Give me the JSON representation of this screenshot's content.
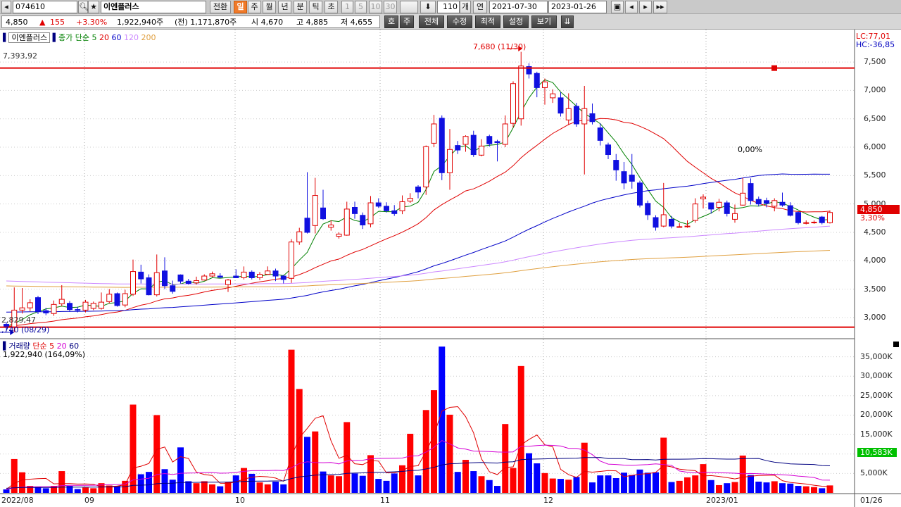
{
  "toolbar": {
    "code": "074610",
    "name": "이엔플러스",
    "convert_label": "전환",
    "periods": [
      "일",
      "주",
      "월",
      "년",
      "분",
      "틱",
      "초"
    ],
    "active_period": "일",
    "intervals": [
      "1",
      "5",
      "10",
      "30"
    ],
    "count": "110",
    "count_unit": "개",
    "year_label": "연",
    "start_date": "2021-07-30",
    "end_date": "2023-01-26"
  },
  "quote": {
    "price": "4,850",
    "change": "155",
    "change_pct": "+3.30%",
    "volume": "1,922,940주",
    "prev_volume": "(전) 1,171,870주",
    "open": "시 4,670",
    "high": "고 4,885",
    "low": "저 4,655"
  },
  "toolbar2": {
    "buttons": [
      "호",
      "주",
      "전체",
      "수정",
      "최적",
      "설정",
      "보기"
    ]
  },
  "price_panel": {
    "legend_name": "이엔플러스",
    "ma_title": "종가 단순",
    "ma_periods": [
      "5",
      "20",
      "60",
      "120",
      "200"
    ],
    "ma_colors": [
      "#008000",
      "#e00000",
      "#0000c8",
      "#cc88ff",
      "#e0a040"
    ],
    "high_marker": "7,680 (11/30)",
    "line_high": "7,393,92",
    "line_low": "2,829,47",
    "low_marker": ",740 (08/29)",
    "lc": "LC:77,01",
    "hc": "HC:-36,85",
    "current_price": "4,850",
    "current_change": "3,30%",
    "pct_annotation": "0,00%",
    "y_ticks": [
      "7,500",
      "7,000",
      "6,500",
      "6,000",
      "5,500",
      "5,000",
      "4,500",
      "4,000",
      "3,500",
      "3,000"
    ]
  },
  "volume_panel": {
    "title": "거래량",
    "ma_title": "단순",
    "ma_periods": [
      "5",
      "20",
      "60"
    ],
    "ma_colors": [
      "#e00000",
      "#d400d4",
      "#000080"
    ],
    "value": "1,922,940 (164,09%)",
    "current": "10,583K",
    "y_ticks": [
      "35,000K",
      "30,000K",
      "25,000K",
      "20,000K",
      "15,000K",
      "10,000K",
      "5,000K"
    ]
  },
  "x_axis": {
    "labels": [
      "2022/08",
      "09",
      "10",
      "11",
      "12",
      "2023/01"
    ],
    "right_label": "01/26"
  },
  "chart_data": {
    "type": "candlestick+volume",
    "ylim_price": [
      2800,
      7700
    ],
    "ylim_volume": [
      0,
      38000
    ],
    "candles": [
      {
        "o": 2880,
        "c": 2840,
        "h": 2920,
        "l": 2790,
        "v": 900,
        "up": false
      },
      {
        "o": 2830,
        "c": 3130,
        "h": 3530,
        "l": 2740,
        "v": 8700,
        "up": true
      },
      {
        "o": 3130,
        "c": 3170,
        "h": 3520,
        "l": 3070,
        "v": 5300,
        "up": true
      },
      {
        "o": 3170,
        "c": 3260,
        "h": 3320,
        "l": 3110,
        "v": 1800,
        "up": true
      },
      {
        "o": 3350,
        "c": 3110,
        "h": 3380,
        "l": 3060,
        "v": 1600,
        "up": false
      },
      {
        "o": 3120,
        "c": 3080,
        "h": 3170,
        "l": 3040,
        "v": 1200,
        "up": false
      },
      {
        "o": 3070,
        "c": 3230,
        "h": 3300,
        "l": 3030,
        "v": 1800,
        "up": true
      },
      {
        "o": 3240,
        "c": 3320,
        "h": 3570,
        "l": 3200,
        "v": 5600,
        "up": true
      },
      {
        "o": 3250,
        "c": 3140,
        "h": 3290,
        "l": 3100,
        "v": 1800,
        "up": false
      },
      {
        "o": 3140,
        "c": 3140,
        "h": 3190,
        "l": 3090,
        "v": 1000,
        "up": false
      },
      {
        "o": 3130,
        "c": 3270,
        "h": 3310,
        "l": 3090,
        "v": 1400,
        "up": true
      },
      {
        "o": 3250,
        "c": 3160,
        "h": 3280,
        "l": 3130,
        "v": 1200,
        "up": true
      },
      {
        "o": 3160,
        "c": 3270,
        "h": 3440,
        "l": 3140,
        "v": 2500,
        "up": true
      },
      {
        "o": 3280,
        "c": 3410,
        "h": 3500,
        "l": 3250,
        "v": 1900,
        "up": true
      },
      {
        "o": 3420,
        "c": 3210,
        "h": 3440,
        "l": 3190,
        "v": 1800,
        "up": false
      },
      {
        "o": 3220,
        "c": 3420,
        "h": 3490,
        "l": 3180,
        "v": 3100,
        "up": true
      },
      {
        "o": 3410,
        "c": 3810,
        "h": 4020,
        "l": 3380,
        "v": 22700,
        "up": true
      },
      {
        "o": 3800,
        "c": 3680,
        "h": 3930,
        "l": 3600,
        "v": 4800,
        "up": false
      },
      {
        "o": 3700,
        "c": 3400,
        "h": 3760,
        "l": 3390,
        "v": 5400,
        "up": false
      },
      {
        "o": 3400,
        "c": 3790,
        "h": 4110,
        "l": 3370,
        "v": 20000,
        "up": true
      },
      {
        "o": 3820,
        "c": 3560,
        "h": 4060,
        "l": 3500,
        "v": 6100,
        "up": false
      },
      {
        "o": 3560,
        "c": 3460,
        "h": 3650,
        "l": 3420,
        "v": 3400,
        "up": false
      },
      {
        "o": 3640,
        "c": 3750,
        "h": 3760,
        "l": 3600,
        "v": 11700,
        "up": false
      },
      {
        "o": 3640,
        "c": 3600,
        "h": 3680,
        "l": 3580,
        "v": 3000,
        "up": false
      },
      {
        "o": 3610,
        "c": 3650,
        "h": 3720,
        "l": 3580,
        "v": 2500,
        "up": true
      },
      {
        "o": 3660,
        "c": 3730,
        "h": 3760,
        "l": 3650,
        "v": 3000,
        "up": true
      },
      {
        "o": 3730,
        "c": 3770,
        "h": 3810,
        "l": 3710,
        "v": 2200,
        "up": true
      },
      {
        "o": 3730,
        "c": 3710,
        "h": 3780,
        "l": 3690,
        "v": 1700,
        "up": false
      },
      {
        "o": 3580,
        "c": 3660,
        "h": 3680,
        "l": 3450,
        "v": 2800,
        "up": true
      },
      {
        "o": 3730,
        "c": 3700,
        "h": 3850,
        "l": 3700,
        "v": 4500,
        "up": false
      },
      {
        "o": 3700,
        "c": 3800,
        "h": 3900,
        "l": 3670,
        "v": 6400,
        "up": true
      },
      {
        "o": 3800,
        "c": 3700,
        "h": 3830,
        "l": 3670,
        "v": 4900,
        "up": false
      },
      {
        "o": 3700,
        "c": 3760,
        "h": 3800,
        "l": 3660,
        "v": 2700,
        "up": true
      },
      {
        "o": 3760,
        "c": 3820,
        "h": 3900,
        "l": 3760,
        "v": 2200,
        "up": true
      },
      {
        "o": 3820,
        "c": 3730,
        "h": 3860,
        "l": 3640,
        "v": 2900,
        "up": false
      },
      {
        "o": 3730,
        "c": 3670,
        "h": 3750,
        "l": 3600,
        "v": 2200,
        "up": false
      },
      {
        "o": 3690,
        "c": 4330,
        "h": 4380,
        "l": 3610,
        "v": 36800,
        "up": true
      },
      {
        "o": 4330,
        "c": 4510,
        "h": 4580,
        "l": 4280,
        "v": 26700,
        "up": true
      },
      {
        "o": 4750,
        "c": 4500,
        "h": 5560,
        "l": 4480,
        "v": 14400,
        "up": false
      },
      {
        "o": 4620,
        "c": 5150,
        "h": 5460,
        "l": 4480,
        "v": 15800,
        "up": true
      },
      {
        "o": 4930,
        "c": 4740,
        "h": 5250,
        "l": 4720,
        "v": 5500,
        "up": false
      },
      {
        "o": 4590,
        "c": 4630,
        "h": 4710,
        "l": 4530,
        "v": 4500,
        "up": true
      },
      {
        "o": 4470,
        "c": 4430,
        "h": 4500,
        "l": 4390,
        "v": 4300,
        "up": true
      },
      {
        "o": 4450,
        "c": 4910,
        "h": 5040,
        "l": 4440,
        "v": 18200,
        "up": true
      },
      {
        "o": 4940,
        "c": 4830,
        "h": 5040,
        "l": 4740,
        "v": 5000,
        "up": false
      },
      {
        "o": 4800,
        "c": 4630,
        "h": 4850,
        "l": 4560,
        "v": 4400,
        "up": false
      },
      {
        "o": 4650,
        "c": 5020,
        "h": 5140,
        "l": 4590,
        "v": 9700,
        "up": true
      },
      {
        "o": 5020,
        "c": 4960,
        "h": 5100,
        "l": 4930,
        "v": 3600,
        "up": false
      },
      {
        "o": 4960,
        "c": 4880,
        "h": 5030,
        "l": 4850,
        "v": 3100,
        "up": false
      },
      {
        "o": 4880,
        "c": 4830,
        "h": 4980,
        "l": 4790,
        "v": 5000,
        "up": false
      },
      {
        "o": 4880,
        "c": 5040,
        "h": 5150,
        "l": 4820,
        "v": 7100,
        "up": true
      },
      {
        "o": 5050,
        "c": 5100,
        "h": 5190,
        "l": 5020,
        "v": 15200,
        "up": true
      },
      {
        "o": 5210,
        "c": 5300,
        "h": 5330,
        "l": 5100,
        "v": 4500,
        "up": false
      },
      {
        "o": 5300,
        "c": 6010,
        "h": 6030,
        "l": 5160,
        "v": 21300,
        "up": true
      },
      {
        "o": 6070,
        "c": 6410,
        "h": 6570,
        "l": 6000,
        "v": 26400,
        "up": true
      },
      {
        "o": 6510,
        "c": 5550,
        "h": 6560,
        "l": 5420,
        "v": 37600,
        "up": false
      },
      {
        "o": 5550,
        "c": 5960,
        "h": 6320,
        "l": 5250,
        "v": 20100,
        "up": true
      },
      {
        "o": 5950,
        "c": 6030,
        "h": 6110,
        "l": 5880,
        "v": 5400,
        "up": false
      },
      {
        "o": 6050,
        "c": 6190,
        "h": 6210,
        "l": 5920,
        "v": 8500,
        "up": true
      },
      {
        "o": 6210,
        "c": 5870,
        "h": 6290,
        "l": 5830,
        "v": 5600,
        "up": false
      },
      {
        "o": 5860,
        "c": 6020,
        "h": 6140,
        "l": 5840,
        "v": 4300,
        "up": true
      },
      {
        "o": 6190,
        "c": 6060,
        "h": 6220,
        "l": 6010,
        "v": 3300,
        "up": false
      },
      {
        "o": 6080,
        "c": 6100,
        "h": 6130,
        "l": 5750,
        "v": 1800,
        "up": false
      },
      {
        "o": 6050,
        "c": 6410,
        "h": 6560,
        "l": 6000,
        "v": 17700,
        "up": true
      },
      {
        "o": 6420,
        "c": 7120,
        "h": 7160,
        "l": 6350,
        "v": 6400,
        "up": true
      },
      {
        "o": 6500,
        "c": 7430,
        "h": 7680,
        "l": 6380,
        "v": 32600,
        "up": true
      },
      {
        "o": 7420,
        "c": 7290,
        "h": 7480,
        "l": 7210,
        "v": 10200,
        "up": false
      },
      {
        "o": 7300,
        "c": 7050,
        "h": 7330,
        "l": 6880,
        "v": 7600,
        "up": false
      },
      {
        "o": 7150,
        "c": 7050,
        "h": 7210,
        "l": 6750,
        "v": 5100,
        "up": true
      },
      {
        "o": 6940,
        "c": 6870,
        "h": 7020,
        "l": 6780,
        "v": 3700,
        "up": true
      },
      {
        "o": 6870,
        "c": 6600,
        "h": 6970,
        "l": 6540,
        "v": 3600,
        "up": false
      },
      {
        "o": 6480,
        "c": 6680,
        "h": 6950,
        "l": 6390,
        "v": 3400,
        "up": true
      },
      {
        "o": 6720,
        "c": 6410,
        "h": 6780,
        "l": 6360,
        "v": 4100,
        "up": false
      },
      {
        "o": 6680,
        "c": 6410,
        "h": 7080,
        "l": 5520,
        "v": 12900,
        "up": true
      },
      {
        "o": 6590,
        "c": 6450,
        "h": 6770,
        "l": 6400,
        "v": 2700,
        "up": false
      },
      {
        "o": 6340,
        "c": 6120,
        "h": 6420,
        "l": 6030,
        "v": 4500,
        "up": false
      },
      {
        "o": 6040,
        "c": 5870,
        "h": 6080,
        "l": 5790,
        "v": 4500,
        "up": false
      },
      {
        "o": 5770,
        "c": 5600,
        "h": 5880,
        "l": 5410,
        "v": 3800,
        "up": false
      },
      {
        "o": 5570,
        "c": 5370,
        "h": 5740,
        "l": 5260,
        "v": 5200,
        "up": false
      },
      {
        "o": 5400,
        "c": 5510,
        "h": 5880,
        "l": 5270,
        "v": 4600,
        "up": false
      },
      {
        "o": 5370,
        "c": 4980,
        "h": 5410,
        "l": 4940,
        "v": 6000,
        "up": false
      },
      {
        "o": 5010,
        "c": 4810,
        "h": 5060,
        "l": 4720,
        "v": 5200,
        "up": false
      },
      {
        "o": 4760,
        "c": 4590,
        "h": 4800,
        "l": 4530,
        "v": 5300,
        "up": false
      },
      {
        "o": 4610,
        "c": 4810,
        "h": 5370,
        "l": 4590,
        "v": 14200,
        "up": true
      },
      {
        "o": 4730,
        "c": 4610,
        "h": 4790,
        "l": 4570,
        "v": 2800,
        "up": false
      },
      {
        "o": 4590,
        "c": 4600,
        "h": 4660,
        "l": 4590,
        "v": 3100,
        "up": true
      },
      {
        "o": 4610,
        "c": 4600,
        "h": 4710,
        "l": 4580,
        "v": 4000,
        "up": true
      },
      {
        "o": 4710,
        "c": 5000,
        "h": 5100,
        "l": 4670,
        "v": 4500,
        "up": true
      },
      {
        "o": 5120,
        "c": 5090,
        "h": 5170,
        "l": 4920,
        "v": 7400,
        "up": true
      },
      {
        "o": 5020,
        "c": 4910,
        "h": 5020,
        "l": 4830,
        "v": 3300,
        "up": false
      },
      {
        "o": 4940,
        "c": 5030,
        "h": 5090,
        "l": 4870,
        "v": 2000,
        "up": true
      },
      {
        "o": 5020,
        "c": 4830,
        "h": 5060,
        "l": 4780,
        "v": 2500,
        "up": false
      },
      {
        "o": 4830,
        "c": 4730,
        "h": 4990,
        "l": 4670,
        "v": 2800,
        "up": true
      },
      {
        "o": 4980,
        "c": 5190,
        "h": 5460,
        "l": 4970,
        "v": 9600,
        "up": true
      },
      {
        "o": 5360,
        "c": 5060,
        "h": 5450,
        "l": 4990,
        "v": 4600,
        "up": false
      },
      {
        "o": 5080,
        "c": 5000,
        "h": 5130,
        "l": 4960,
        "v": 2900,
        "up": false
      },
      {
        "o": 5060,
        "c": 5010,
        "h": 5110,
        "l": 4940,
        "v": 2700,
        "up": false
      },
      {
        "o": 5060,
        "c": 4960,
        "h": 5100,
        "l": 4870,
        "v": 3000,
        "up": true
      },
      {
        "o": 4980,
        "c": 5030,
        "h": 5200,
        "l": 4950,
        "v": 2500,
        "up": false
      },
      {
        "o": 4970,
        "c": 4800,
        "h": 5030,
        "l": 4780,
        "v": 2400,
        "up": false
      },
      {
        "o": 4850,
        "c": 4670,
        "h": 4870,
        "l": 4640,
        "v": 1800,
        "up": false
      },
      {
        "o": 4670,
        "c": 4660,
        "h": 4710,
        "l": 4640,
        "v": 1700,
        "up": true
      },
      {
        "o": 4670,
        "c": 4680,
        "h": 4710,
        "l": 4650,
        "v": 1500,
        "up": true
      },
      {
        "o": 4670,
        "c": 4770,
        "h": 4790,
        "l": 4640,
        "v": 1200,
        "up": false
      },
      {
        "o": 4670,
        "c": 4850,
        "h": 4885,
        "l": 4655,
        "v": 1923,
        "up": true
      }
    ]
  }
}
